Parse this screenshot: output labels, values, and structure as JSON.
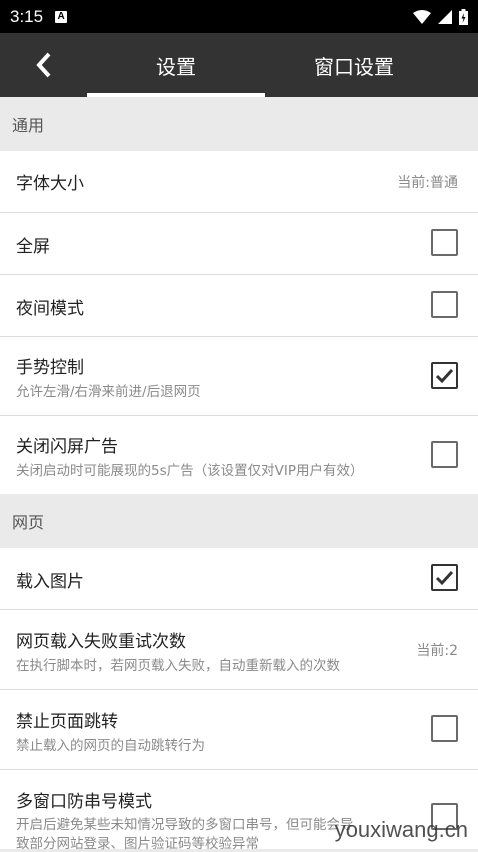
{
  "status_bar": {
    "time": "3:15",
    "notification_icon": "A"
  },
  "toolbar": {
    "tabs": [
      {
        "label": "设置",
        "selected": true
      },
      {
        "label": "窗口设置",
        "selected": false
      }
    ]
  },
  "sections": [
    {
      "header": "通用"
    },
    {
      "header": "网页"
    }
  ],
  "items": [
    {
      "title": "字体大小",
      "value": "当前:普通"
    },
    {
      "title": "全屏",
      "checked": false
    },
    {
      "title": "夜间模式",
      "checked": false
    },
    {
      "title": "手势控制",
      "summary": "允许左滑/右滑来前进/后退网页",
      "checked": true
    },
    {
      "title": "关闭闪屏广告",
      "summary": "关闭启动时可能展现的5s广告（该设置仅对VIP用户有效）",
      "checked": false
    },
    {
      "title": "载入图片",
      "checked": true
    },
    {
      "title": "网页载入失败重试次数",
      "summary": "在执行脚本时，若网页载入失败，自动重新载入的次数",
      "value": "当前:2"
    },
    {
      "title": "禁止页面跳转",
      "summary": "禁止载入的网页的自动跳转行为",
      "checked": false
    },
    {
      "title": "多窗口防串号模式",
      "summary": "开启后避免某些未知情况导致的多窗口串号，但可能会导",
      "summary2": "致部分网站登录、图片验证码等校验异常",
      "checked": false
    }
  ],
  "watermark": "youxiwang.cn"
}
